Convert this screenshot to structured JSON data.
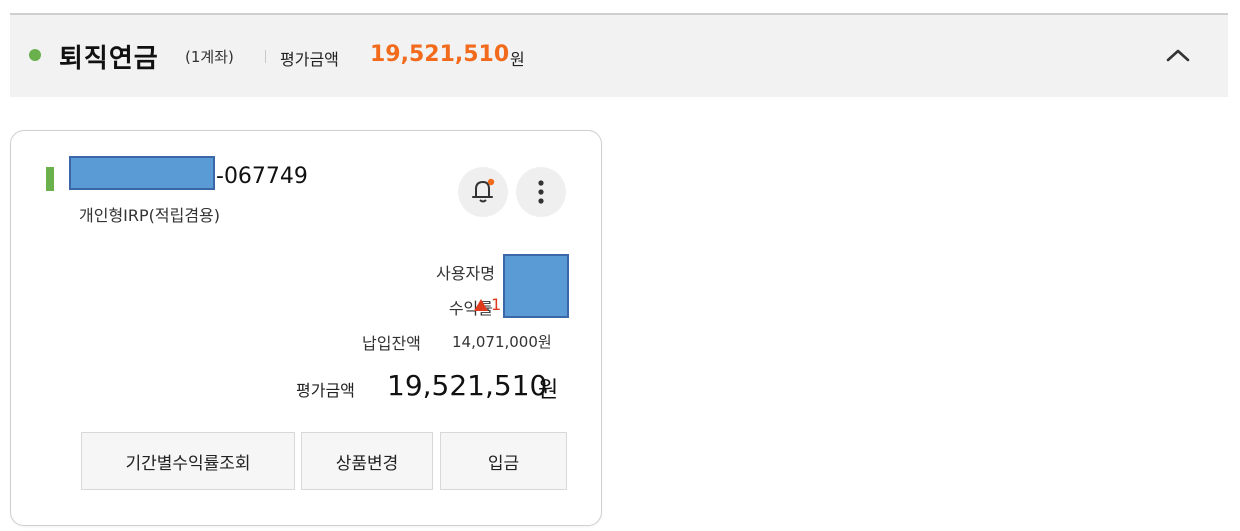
{
  "header": {
    "title": "퇴직연금",
    "count": "(1계좌)",
    "eval_label": "평가금액",
    "eval_value": "19,521,510",
    "eval_unit": "원"
  },
  "colors": {
    "accent_green": "#6ab04c",
    "accent_orange": "#f26b1d",
    "up_red": "#e03a1e",
    "mask_blue": "#5b9bd5"
  },
  "card": {
    "account_number_suffix": "-067749",
    "account_type": "개인형IRP(적립겸용)",
    "icons": [
      "bell-icon",
      "more-vertical-icon"
    ],
    "user_alias_label": "사용자명",
    "yield_label": "수익률",
    "yield_value": "1",
    "paid_balance_label": "납입잔액",
    "paid_balance_value": "14,071,000원",
    "total_label": "평가금액",
    "total_value": "19,521,510",
    "total_unit": "원",
    "buttons": [
      "기간별수익률조회",
      "상품변경",
      "입금"
    ]
  }
}
